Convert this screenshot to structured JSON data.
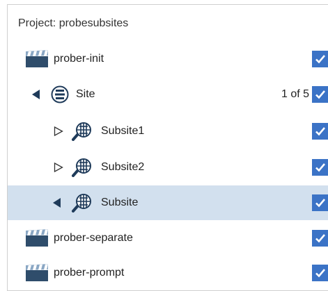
{
  "header": {
    "project_label": "Project: probesubsites"
  },
  "accent_color": "#3b73c6",
  "selected_row_color": "#d2e0ee",
  "tree": [
    {
      "label": "prober-init",
      "icon": "clapperboard-icon",
      "level": 0,
      "expander": "none",
      "checked": true
    },
    {
      "label": "Site",
      "icon": "site-globe-icon",
      "level": 1,
      "expander": "expanded",
      "count": "1 of 5",
      "checked": true
    },
    {
      "label": "Subsite1",
      "icon": "subsite-search-globe-icon",
      "level": 2,
      "expander": "collapsed",
      "checked": true
    },
    {
      "label": "Subsite2",
      "icon": "subsite-search-globe-icon",
      "level": 2,
      "expander": "collapsed",
      "checked": true
    },
    {
      "label": "Subsite",
      "icon": "subsite-search-globe-icon",
      "level": 2,
      "expander": "expanded",
      "checked": true,
      "selected": true
    },
    {
      "label": "prober-separate",
      "icon": "clapperboard-icon",
      "level": 0,
      "expander": "none",
      "checked": true
    },
    {
      "label": "prober-prompt",
      "icon": "clapperboard-icon",
      "level": 0,
      "expander": "none",
      "checked": true
    }
  ]
}
